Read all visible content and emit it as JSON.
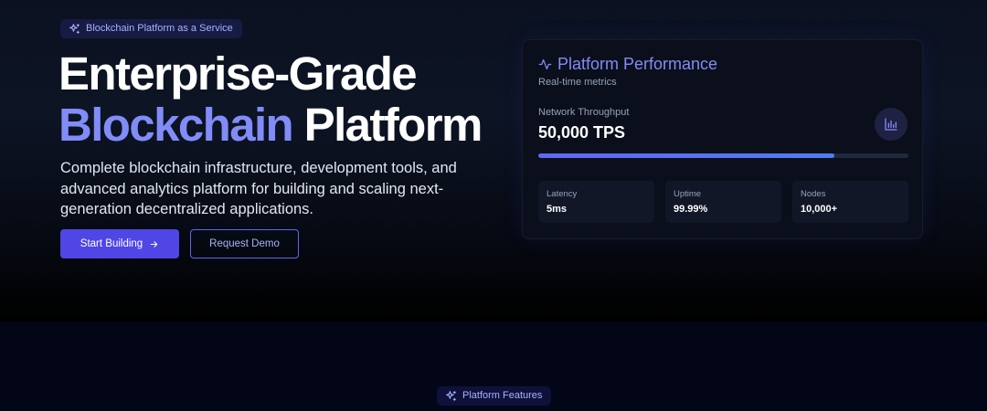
{
  "hero": {
    "badge": "Blockchain Platform as a Service",
    "headline_line1": "Enterprise-Grade",
    "headline_accent": "Blockchain",
    "headline_rest": " Platform",
    "description": "Complete blockchain infrastructure, development tools, and advanced analytics platform for building and scaling next-generation decentralized applications.",
    "primary_button": "Start Building",
    "secondary_button": "Request Demo",
    "badge_icon": "sparkles-icon",
    "primary_button_icon": "arrow-right-icon"
  },
  "performance_card": {
    "title": "Platform Performance",
    "title_icon": "activity-icon",
    "subtitle": "Real-time metrics",
    "metric_label": "Network Throughput",
    "metric_value": "50,000 TPS",
    "chart_icon": "bar-chart-icon",
    "progress_fraction": 0.8,
    "stats": [
      {
        "label": "Latency",
        "value": "5ms"
      },
      {
        "label": "Uptime",
        "value": "99.99%"
      },
      {
        "label": "Nodes",
        "value": "10,000+"
      }
    ]
  },
  "features": {
    "badge": "Platform Features",
    "badge_icon": "sparkles-icon"
  },
  "colors": {
    "accent": "#818cf8",
    "primary_button": "#4f46e5",
    "background": "#020617"
  }
}
